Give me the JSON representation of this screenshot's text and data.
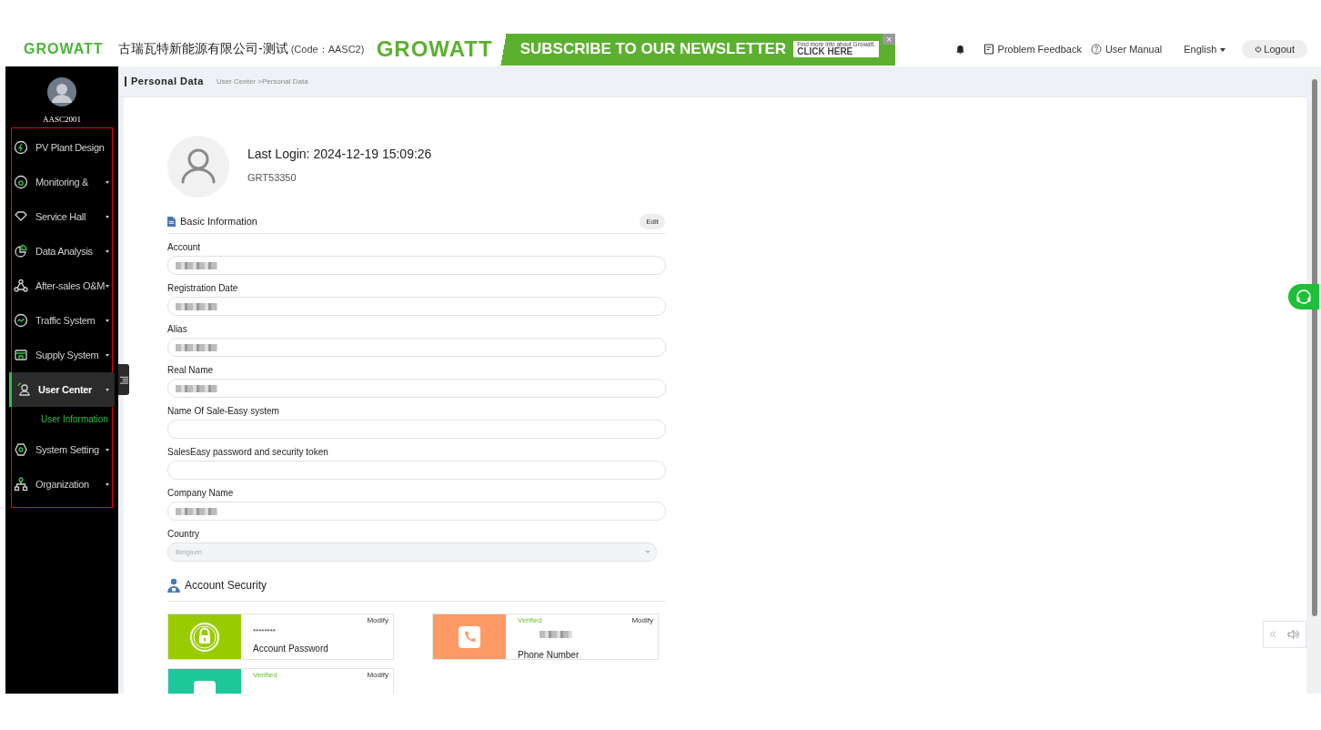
{
  "header": {
    "logo": "GROWATT",
    "company": "古瑞瓦特新能源有限公司-测试",
    "code": "(Code：AASC2)",
    "banner": {
      "logo": "GROWATT",
      "headline": "SUBSCRIBE TO OUR NEWSLETTER",
      "small": "Find more info about Growatt.",
      "cta": "CLICK HERE",
      "close": "×"
    },
    "links": [
      {
        "label": "Problem Feedback",
        "kind": "feedback"
      },
      {
        "label": "User Manual",
        "kind": "manual"
      }
    ],
    "language": "English",
    "logout": "Logout"
  },
  "sidebar": {
    "user": "AASC2001",
    "items": [
      {
        "label": "PV Plant Design",
        "selected": false,
        "has_caret": false
      },
      {
        "label": "Monitoring &",
        "selected": false,
        "has_caret": true
      },
      {
        "label": "Service Hall",
        "selected": false,
        "has_caret": true
      },
      {
        "label": "Data Analysis",
        "selected": false,
        "has_caret": true
      },
      {
        "label": "After-sales O&M",
        "selected": false,
        "has_caret": true
      },
      {
        "label": "Traffic System",
        "selected": false,
        "has_caret": true
      },
      {
        "label": "Supply System",
        "selected": false,
        "has_caret": true
      },
      {
        "label": "User Center",
        "expanded": true,
        "selected": true,
        "has_caret": true,
        "children": [
          {
            "label": "User Information",
            "selected": true
          }
        ]
      },
      {
        "label": "System Setting",
        "selected": false,
        "has_caret": true
      },
      {
        "label": "Organization",
        "selected": false,
        "has_caret": true
      }
    ]
  },
  "page": {
    "title": "Personal Data",
    "breadcrumb": "User Center >Personal Data"
  },
  "profile": {
    "last_login": "Last Login: 2024-12-19 15:09:26",
    "id": "GRT53350"
  },
  "basic": {
    "title": "Basic Information",
    "edit": "Edit",
    "fields": [
      {
        "label": "Account",
        "redacted": true,
        "kind": "text"
      },
      {
        "label": "Registration Date",
        "redacted": true,
        "kind": "text"
      },
      {
        "label": "Alias",
        "redacted": true,
        "kind": "text"
      },
      {
        "label": "Real Name",
        "redacted": true,
        "kind": "text"
      },
      {
        "label": "Name Of Sale-Easy system",
        "redacted": false,
        "kind": "text"
      },
      {
        "label": "SalesEasy password and security token",
        "redacted": false,
        "kind": "text"
      },
      {
        "label": "Company Name",
        "redacted": true,
        "kind": "text"
      },
      {
        "label": "Country",
        "value": "Belgium",
        "kind": "select"
      }
    ]
  },
  "security": {
    "title": "Account Security",
    "cards": [
      {
        "kind": "password",
        "color": "#99cc00",
        "verified": false,
        "value": "********",
        "label": "Account Password",
        "action": "Modify"
      },
      {
        "kind": "phone",
        "color": "#ff9966",
        "verified": true,
        "verified_text": "Verified",
        "redacted": true,
        "label": "Phone Number",
        "action": "Modify"
      },
      {
        "kind": "email",
        "color": "#1cc79a",
        "verified": true,
        "verified_text": "Verified",
        "action": "Modify"
      }
    ]
  }
}
